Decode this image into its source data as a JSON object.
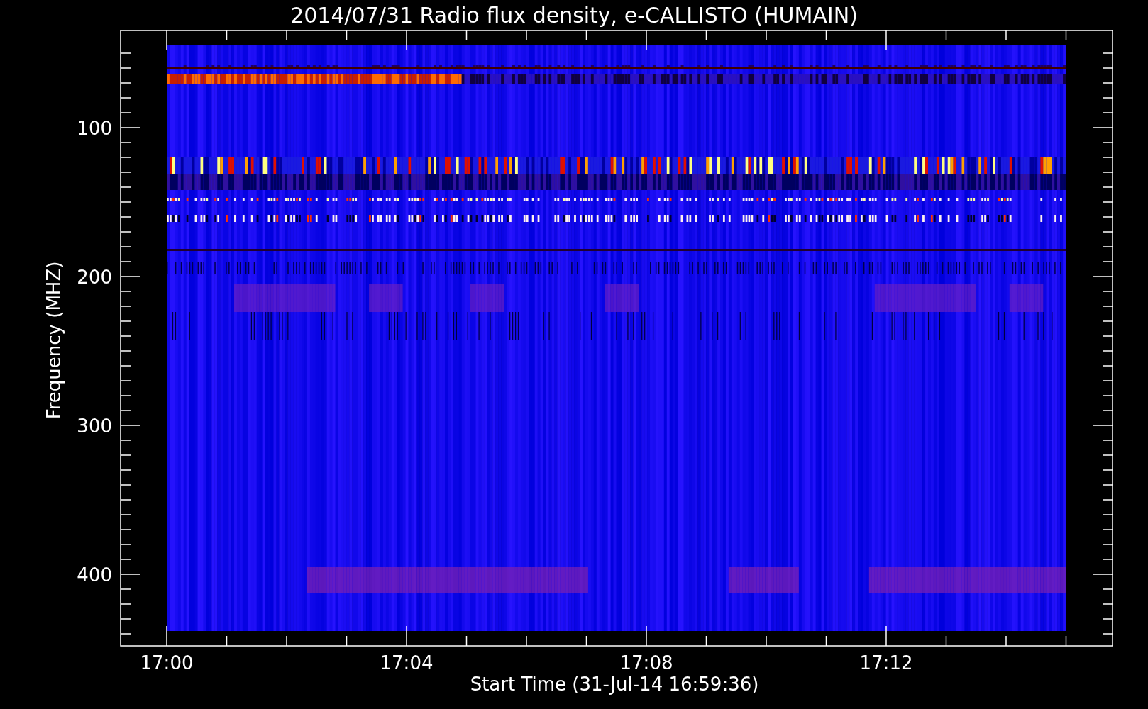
{
  "title": "2014/07/31  Radio flux density, e-CALLISTO (HUMAIN)",
  "y_axis": {
    "label": "Frequency (MHZ)",
    "ticks": [
      "100",
      "200",
      "300",
      "400"
    ]
  },
  "x_axis": {
    "label": "Start Time (31-Jul-14 16:59:36)",
    "ticks": [
      "17:00",
      "17:04",
      "17:08",
      "17:12"
    ]
  }
}
